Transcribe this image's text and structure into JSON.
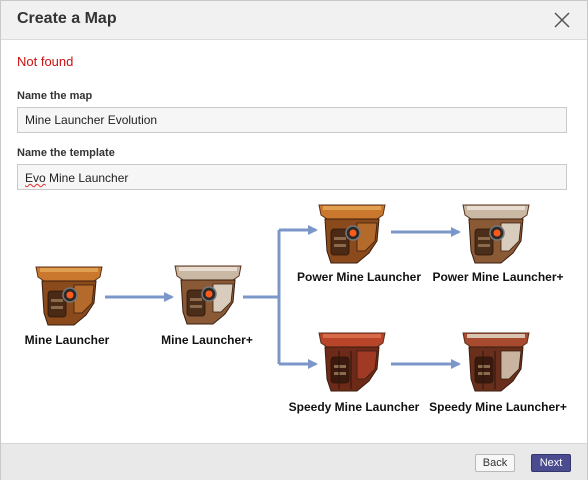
{
  "dialog": {
    "title": "Create a Map",
    "error_text": "Not found",
    "map_name_label": "Name the map",
    "map_name_value": "Mine Launcher Evolution",
    "template_label": "Name the template",
    "template_value_prefix": "Evo",
    "template_value_rest": " Mine Launcher",
    "back_label": "Back",
    "next_label": "Next"
  },
  "diagram": {
    "items": [
      {
        "name": "Mine Launcher",
        "style": "base"
      },
      {
        "name": "Mine Launcher+",
        "style": "plus"
      },
      {
        "name": "Power Mine Launcher",
        "style": "base"
      },
      {
        "name": "Power Mine Launcher+",
        "style": "plus"
      },
      {
        "name": "Speedy Mine Launcher",
        "style": "speedy"
      },
      {
        "name": "Speedy Mine Launcher+",
        "style": "speedy-plus"
      }
    ],
    "arrow_color": "#7b97c9"
  }
}
